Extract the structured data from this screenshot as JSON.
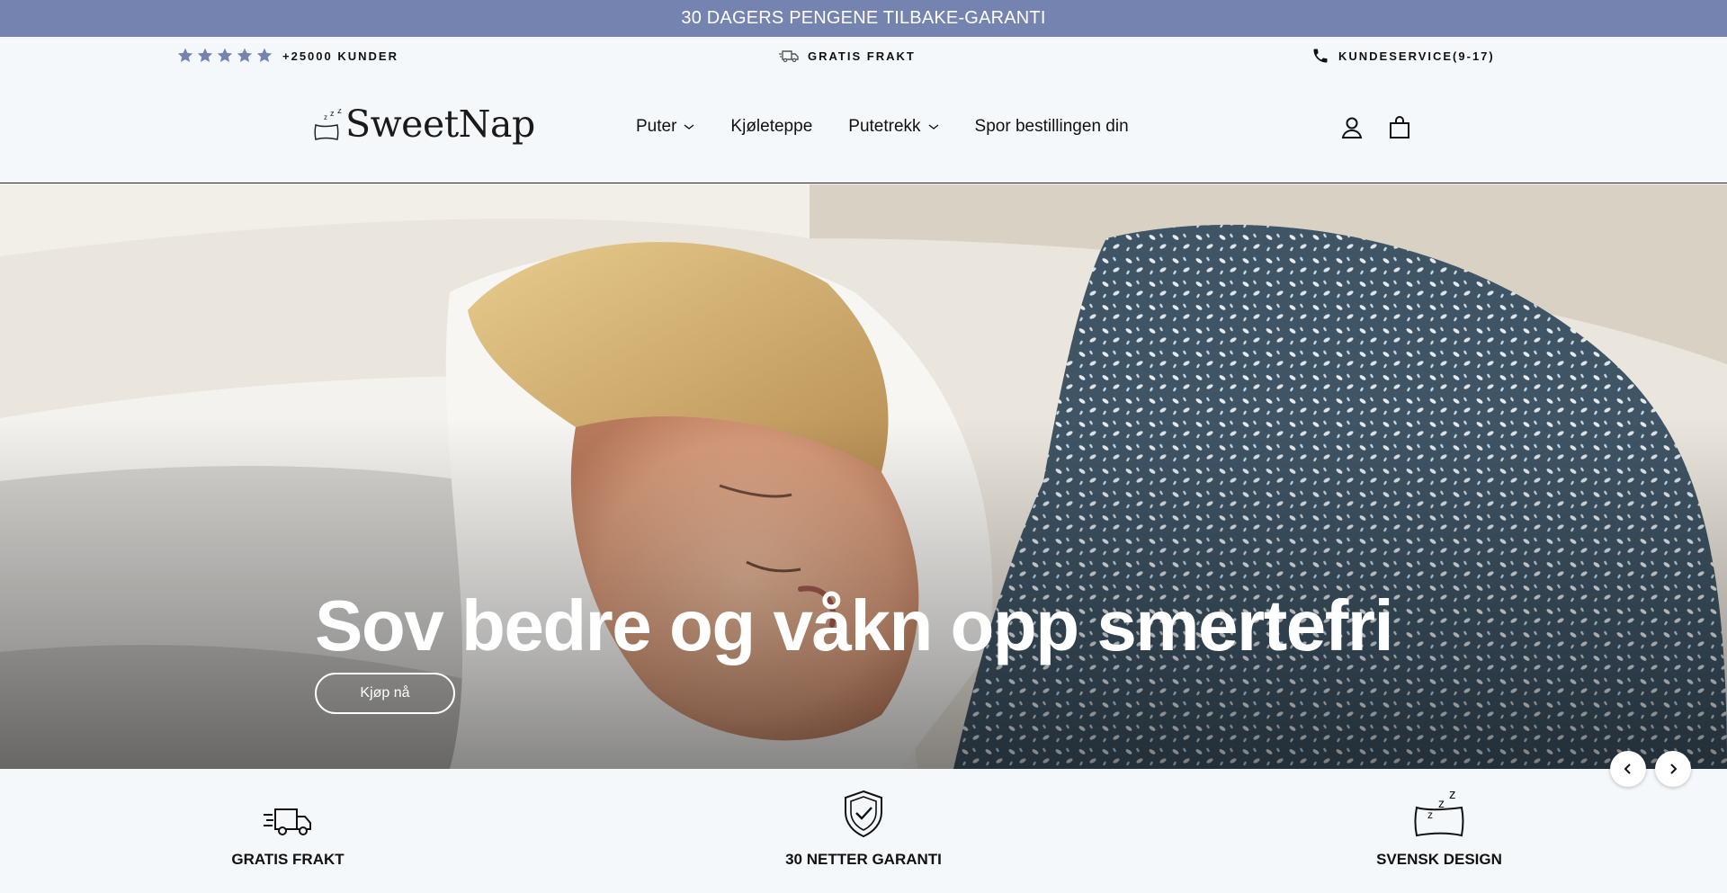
{
  "announcement": "30 DAGERS PENGENE TILBAKE-GARANTI",
  "usp": {
    "customers": "+25000 KUNDER",
    "shipping": "GRATIS FRAKT",
    "service": "KUNDESERVICE(9-17)"
  },
  "logo": {
    "text": "SweetNap"
  },
  "nav": [
    {
      "label": "Puter",
      "has_dropdown": true
    },
    {
      "label": "Kjøleteppe",
      "has_dropdown": false
    },
    {
      "label": "Putetrekk",
      "has_dropdown": true
    },
    {
      "label": "Spor bestillingen din",
      "has_dropdown": false
    }
  ],
  "icons": {
    "account": "user-icon",
    "cart": "cart-icon",
    "stars": "star-icon",
    "truck": "truck-icon",
    "phone": "phone-icon"
  },
  "hero": {
    "title": "Sov bedre og våkn opp smertefri",
    "button": "Kjøp nå"
  },
  "features": [
    {
      "label": "GRATIS FRAKT",
      "icon": "truck-icon"
    },
    {
      "label": "30 NETTER GARANTI",
      "icon": "shield-check-icon"
    },
    {
      "label": "SVENSK DESIGN",
      "icon": "pillow-icon"
    }
  ],
  "colors": {
    "announcement_bg": "#7583b1",
    "star": "#7583b1",
    "page_bg": "#f5f8fb"
  }
}
